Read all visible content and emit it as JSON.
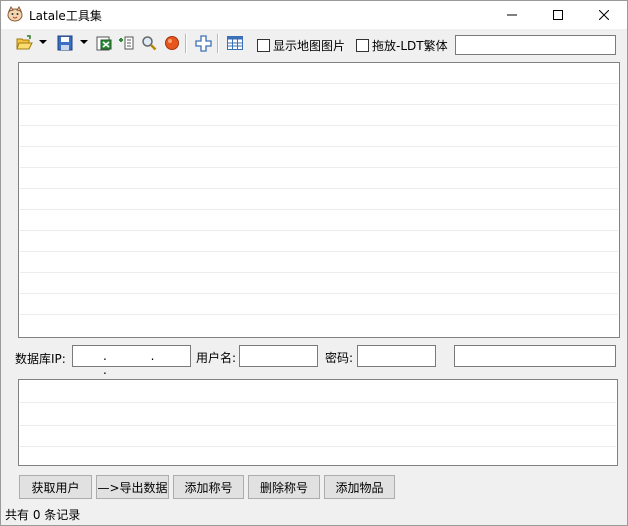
{
  "window": {
    "title": "Latale工具集",
    "controls": {
      "minimize": "minimize-icon",
      "maximize": "maximize-icon",
      "close": "close-icon"
    }
  },
  "toolbar": {
    "icons": [
      "open-folder-icon",
      "save-icon",
      "excel-export-icon",
      "import-icon",
      "search-icon",
      "stop-icon",
      "add-icon",
      "grid-icon"
    ],
    "show_map_image_label": "显示地图图片",
    "show_map_image_checked": false,
    "drag_ldt_label": "拖放-LDT繁体",
    "drag_ldt_checked": false,
    "input_value": ""
  },
  "connection": {
    "db_ip_label": "数据库IP:",
    "ip_value": ". . .",
    "username_label": "用户名:",
    "username_value": "",
    "password_label": "密码:",
    "password_value": "",
    "extra_value": ""
  },
  "buttons": {
    "get_users": "获取用户",
    "export_data": "—>导出数据",
    "add_title": "添加称号",
    "delete_title": "删除称号",
    "add_item": "添加物品"
  },
  "status": {
    "text": "共有 0 条记录"
  },
  "colors": {
    "window_bg": "#f0f0f0",
    "button_bg": "#e1e1e1"
  }
}
